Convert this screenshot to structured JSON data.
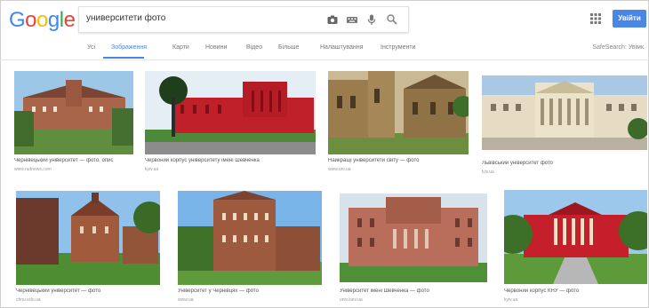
{
  "header": {
    "logo_text": "Google",
    "logo_colors": [
      "#4285f4",
      "#ea4335",
      "#fbbc05",
      "#4285f4",
      "#34a853",
      "#ea4335"
    ],
    "search_query": "университети фото",
    "signin_label": "Увійти",
    "apps_icon": "apps-grid-icon"
  },
  "tabs": {
    "items": [
      "Усі",
      "Зображення",
      "Карти",
      "Новини",
      "Відео",
      "Більше",
      "Налаштування",
      "Інструменти"
    ],
    "active": "Зображення",
    "safesearch_label": "SafeSearch: Увімк."
  },
  "results": [
    {
      "caption": "Чернівецький університет — фото, опис",
      "source": "www.rudnews.com"
    },
    {
      "caption": "Червоний корпус університету імені Шевченка",
      "source": "kyiv.ua"
    },
    {
      "caption": "Найкращі університети світу — фото",
      "source": "www.uni.ua"
    },
    {
      "caption": "Львівський університет фото",
      "source": "lviv.ua"
    },
    {
      "caption": "Чернівецький університет — фото",
      "source": "chnu.edu.ua"
    },
    {
      "caption": "Університет у Чернівцях — фото",
      "source": "www.ua"
    },
    {
      "caption": "Університет імені Шевченка — фото",
      "source": "univ.kiev.ua"
    },
    {
      "caption": "Червоний корпус КНУ — фото",
      "source": "kyiv.ua"
    }
  ],
  "colors": {
    "accent": "#4a86e8",
    "tab_inactive": "#777777"
  }
}
